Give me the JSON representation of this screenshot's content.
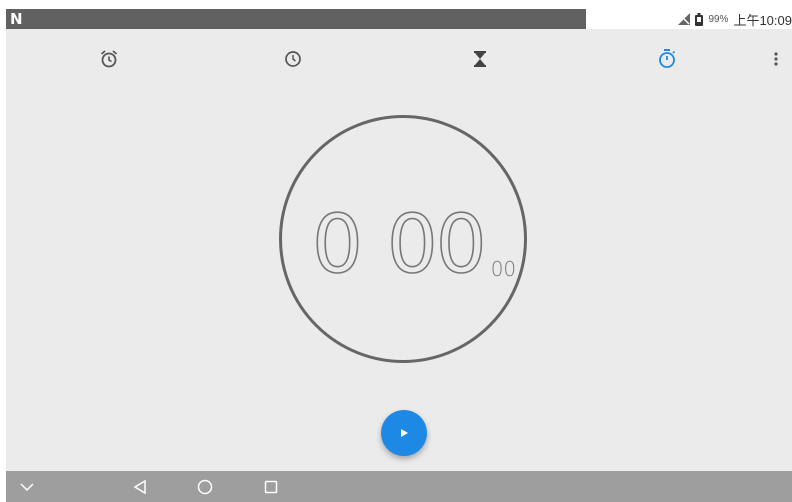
{
  "status_bar": {
    "notification_icon": "n-logo-icon",
    "logo_text": "N",
    "battery_percent": "99%",
    "time": "上午10:09"
  },
  "tabs": [
    {
      "name": "alarm",
      "icon": "alarm-clock-icon",
      "active": false
    },
    {
      "name": "clock",
      "icon": "clock-icon",
      "active": false
    },
    {
      "name": "timer",
      "icon": "hourglass-icon",
      "active": false
    },
    {
      "name": "stopwatch",
      "icon": "stopwatch-icon",
      "active": true
    }
  ],
  "stopwatch": {
    "minutes": "0",
    "seconds": "00",
    "hundredths": "00"
  },
  "colors": {
    "accent": "#1e88e5",
    "background": "#ebebeb",
    "navbar": "#9e9e9e",
    "statusbar": "#616161"
  },
  "fab": {
    "icon": "play-icon"
  },
  "nav": {
    "icons": [
      "chevron-down-icon",
      "back-icon",
      "home-icon",
      "recents-icon"
    ]
  }
}
